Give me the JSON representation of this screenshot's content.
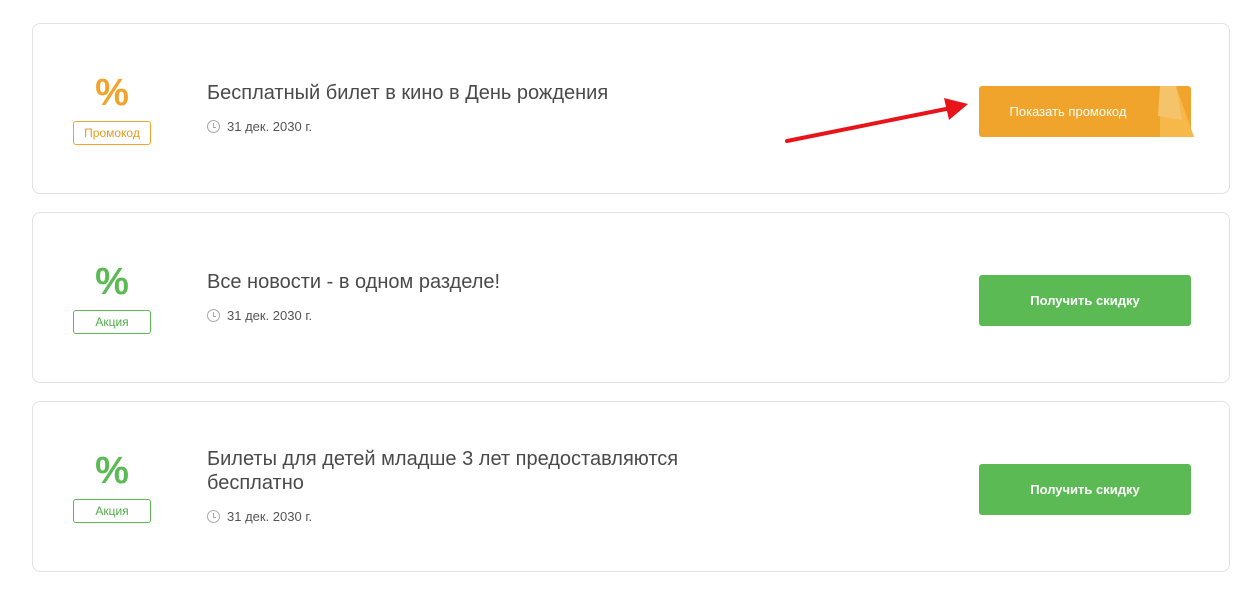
{
  "offers": [
    {
      "variant": "orange",
      "icon": "percent-icon",
      "symbol": "%",
      "tag": "Промокод",
      "title": "Бесплатный билет в кино в День рождения",
      "date": "31 дек. 2030 г.",
      "button": "Показать промокод"
    },
    {
      "variant": "green",
      "icon": "percent-icon",
      "symbol": "%",
      "tag": "Акция",
      "title": "Все новости - в одном разделе!",
      "date": "31 дек. 2030 г.",
      "button": "Получить скидку"
    },
    {
      "variant": "green",
      "icon": "percent-icon",
      "symbol": "%",
      "tag": "Акция",
      "title": "Билеты для детей младше 3 лет предоставляются бесплатно",
      "date": "31 дек. 2030 г.",
      "button": "Получить скидку"
    }
  ],
  "colors": {
    "orange": "#f0a42b",
    "green": "#5cba55",
    "arrow": "#e8141a"
  }
}
